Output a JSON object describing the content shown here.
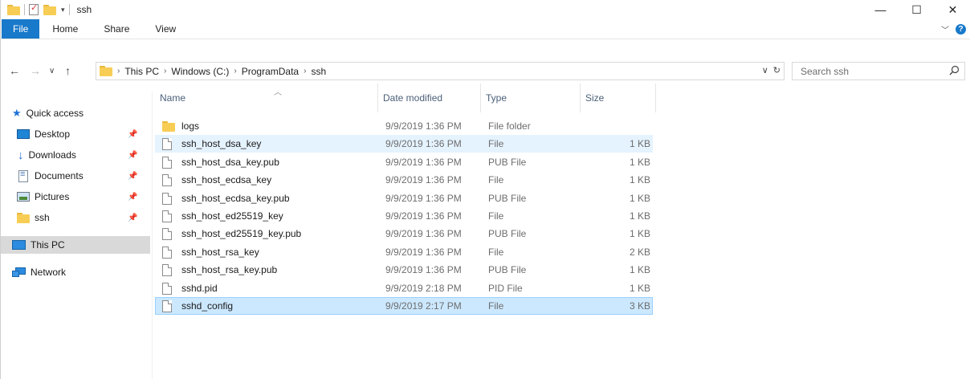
{
  "window": {
    "title": "ssh"
  },
  "ribbon": {
    "tabs": [
      "File",
      "Home",
      "Share",
      "View"
    ]
  },
  "address": {
    "crumbs": [
      "This PC",
      "Windows (C:)",
      "ProgramData",
      "ssh"
    ]
  },
  "search": {
    "placeholder": "Search ssh"
  },
  "nav": {
    "quick_access": "Quick access",
    "items": [
      {
        "label": "Desktop",
        "icon": "desktop-icon",
        "pinned": true
      },
      {
        "label": "Downloads",
        "icon": "downloads-icon",
        "pinned": true
      },
      {
        "label": "Documents",
        "icon": "documents-icon",
        "pinned": true
      },
      {
        "label": "Pictures",
        "icon": "pictures-icon",
        "pinned": true
      },
      {
        "label": "ssh",
        "icon": "folder-icon",
        "pinned": true
      }
    ],
    "this_pc": "This PC",
    "network": "Network"
  },
  "columns": {
    "name": "Name",
    "date": "Date modified",
    "type": "Type",
    "size": "Size"
  },
  "files": [
    {
      "name": "logs",
      "date": "9/9/2019 1:36 PM",
      "type": "File folder",
      "size": "",
      "icon": "folder-icon"
    },
    {
      "name": "ssh_host_dsa_key",
      "date": "9/9/2019 1:36 PM",
      "type": "File",
      "size": "1 KB",
      "icon": "file-icon"
    },
    {
      "name": "ssh_host_dsa_key.pub",
      "date": "9/9/2019 1:36 PM",
      "type": "PUB File",
      "size": "1 KB",
      "icon": "file-icon"
    },
    {
      "name": "ssh_host_ecdsa_key",
      "date": "9/9/2019 1:36 PM",
      "type": "File",
      "size": "1 KB",
      "icon": "file-icon"
    },
    {
      "name": "ssh_host_ecdsa_key.pub",
      "date": "9/9/2019 1:36 PM",
      "type": "PUB File",
      "size": "1 KB",
      "icon": "file-icon"
    },
    {
      "name": "ssh_host_ed25519_key",
      "date": "9/9/2019 1:36 PM",
      "type": "File",
      "size": "1 KB",
      "icon": "file-icon"
    },
    {
      "name": "ssh_host_ed25519_key.pub",
      "date": "9/9/2019 1:36 PM",
      "type": "PUB File",
      "size": "1 KB",
      "icon": "file-icon"
    },
    {
      "name": "ssh_host_rsa_key",
      "date": "9/9/2019 1:36 PM",
      "type": "File",
      "size": "2 KB",
      "icon": "file-icon"
    },
    {
      "name": "ssh_host_rsa_key.pub",
      "date": "9/9/2019 1:36 PM",
      "type": "PUB File",
      "size": "1 KB",
      "icon": "file-icon"
    },
    {
      "name": "sshd.pid",
      "date": "9/9/2019 2:18 PM",
      "type": "PID File",
      "size": "1 KB",
      "icon": "file-icon"
    },
    {
      "name": "sshd_config",
      "date": "9/9/2019 2:17 PM",
      "type": "File",
      "size": "3 KB",
      "icon": "file-icon"
    }
  ],
  "colors": {
    "file_tab": "#1979ca",
    "selection": "#cce8ff",
    "hover": "#e5f3ff",
    "this_pc_highlight": "#d9d9d9"
  }
}
